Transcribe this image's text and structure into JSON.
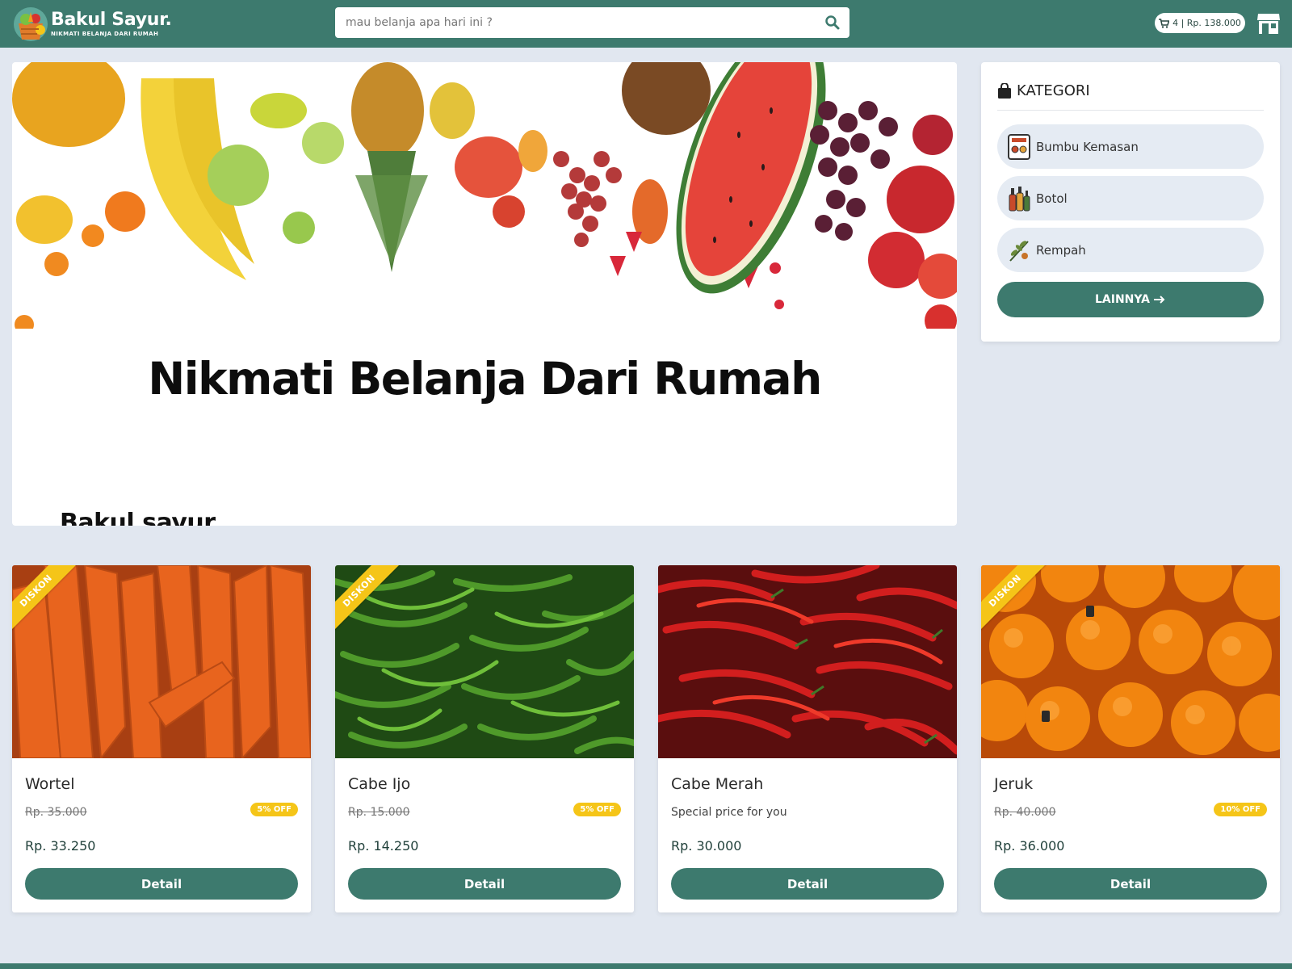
{
  "brand": {
    "title": "Bakul Sayur.",
    "tagline": "NIKMATI BELANJA DARI RUMAH"
  },
  "search": {
    "placeholder": "mau belanja apa hari ini ?"
  },
  "cart": {
    "summary": "4 | Rp. 138.000"
  },
  "hero": {
    "title": "Nikmati Belanja Dari Rumah",
    "subtitle": "Bakul sayur."
  },
  "categories": {
    "heading": "KATEGORI",
    "items": [
      {
        "label": "Bumbu Kemasan",
        "icon": "packaged-spice-icon"
      },
      {
        "label": "Botol",
        "icon": "bottles-icon"
      },
      {
        "label": "Rempah",
        "icon": "herb-icon"
      }
    ],
    "more_label": "LAINNYA"
  },
  "products": [
    {
      "name": "Wortel",
      "old_price": "Rp. 35.000",
      "badge": "5% OFF",
      "price": "Rp. 33.250",
      "ribbon": "DISKON",
      "button": "Detail",
      "image": "carrots"
    },
    {
      "name": "Cabe Ijo",
      "old_price": "Rp. 15.000",
      "badge": "5% OFF",
      "price": "Rp. 14.250",
      "ribbon": "DISKON",
      "button": "Detail",
      "image": "green-chilies"
    },
    {
      "name": "Cabe Merah",
      "note": "Special price for you",
      "price": "Rp. 30.000",
      "button": "Detail",
      "image": "red-chilies"
    },
    {
      "name": "Jeruk",
      "old_price": "Rp. 40.000",
      "badge": "10% OFF",
      "price": "Rp. 36.000",
      "ribbon": "DISKON",
      "button": "Detail",
      "image": "oranges"
    }
  ],
  "colors": {
    "primary": "#3d7a6e",
    "background": "#e1e7f0",
    "accent": "#f5c518"
  }
}
